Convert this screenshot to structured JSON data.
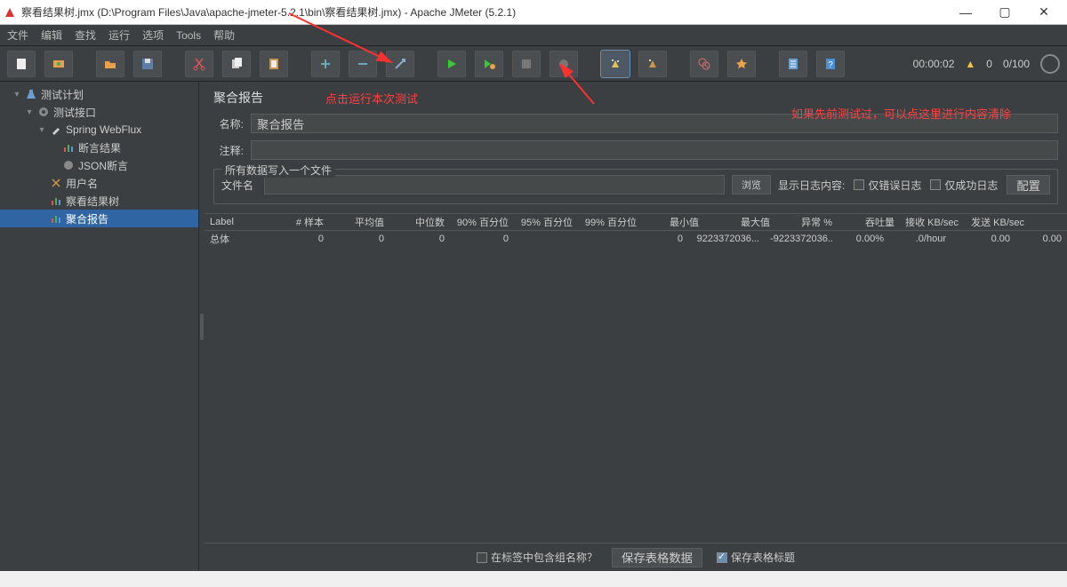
{
  "window": {
    "title": "察看结果树.jmx (D:\\Program Files\\Java\\apache-jmeter-5.2.1\\bin\\察看结果树.jmx) - Apache JMeter (5.2.1)",
    "min": "—",
    "max": "▢",
    "close": "✕"
  },
  "menu": [
    "文件",
    "编辑",
    "查找",
    "运行",
    "选项",
    "Tools",
    "帮助"
  ],
  "toolbar_status": {
    "time": "00:00:02",
    "warn_count": "0",
    "threads": "0/100"
  },
  "tree": {
    "root": "测试计划",
    "n1": "测试接口",
    "n2": "Spring WebFlux",
    "n3a": "断言结果",
    "n3b": "JSON断言",
    "n3c": "用户名",
    "n3d": "察看结果树",
    "n3e": "聚合报告"
  },
  "panel": {
    "title": "聚合报告",
    "run_note": "点击运行本次测试",
    "right_note": "如果先前测试过，可以点这里进行内容清除",
    "name_lbl": "名称:",
    "name_val": "聚合报告",
    "comment_lbl": "注释:",
    "comment_val": "",
    "file_group": "所有数据写入一个文件",
    "file_lbl": "文件名",
    "browse": "浏览",
    "log_opts_lbl": "显示日志内容:",
    "only_err": "仅错误日志",
    "only_ok": "仅成功日志",
    "config": "配置"
  },
  "table": {
    "headers": [
      "Label",
      "# 样本",
      "平均值",
      "中位数",
      "90% 百分位",
      "95% 百分位",
      "99% 百分位",
      "最小值",
      "最大值",
      "异常 %",
      "吞吐量",
      "接收 KB/sec",
      "发送 KB/sec"
    ],
    "row": {
      "label": "总体",
      "samples": "0",
      "avg": "0",
      "median": "0",
      "p90": "0",
      "p95": "",
      "p99": "",
      "min": "0",
      "max": "9223372036...",
      "maxr": "-9223372036...",
      "err": "0.00%",
      "thr": ".0/hour",
      "rkb": "0.00",
      "skb": "0.00"
    }
  },
  "footer": {
    "include_group": "在标签中包含组名称？",
    "save_data": "保存表格数据",
    "save_hdr": "保存表格标题"
  }
}
